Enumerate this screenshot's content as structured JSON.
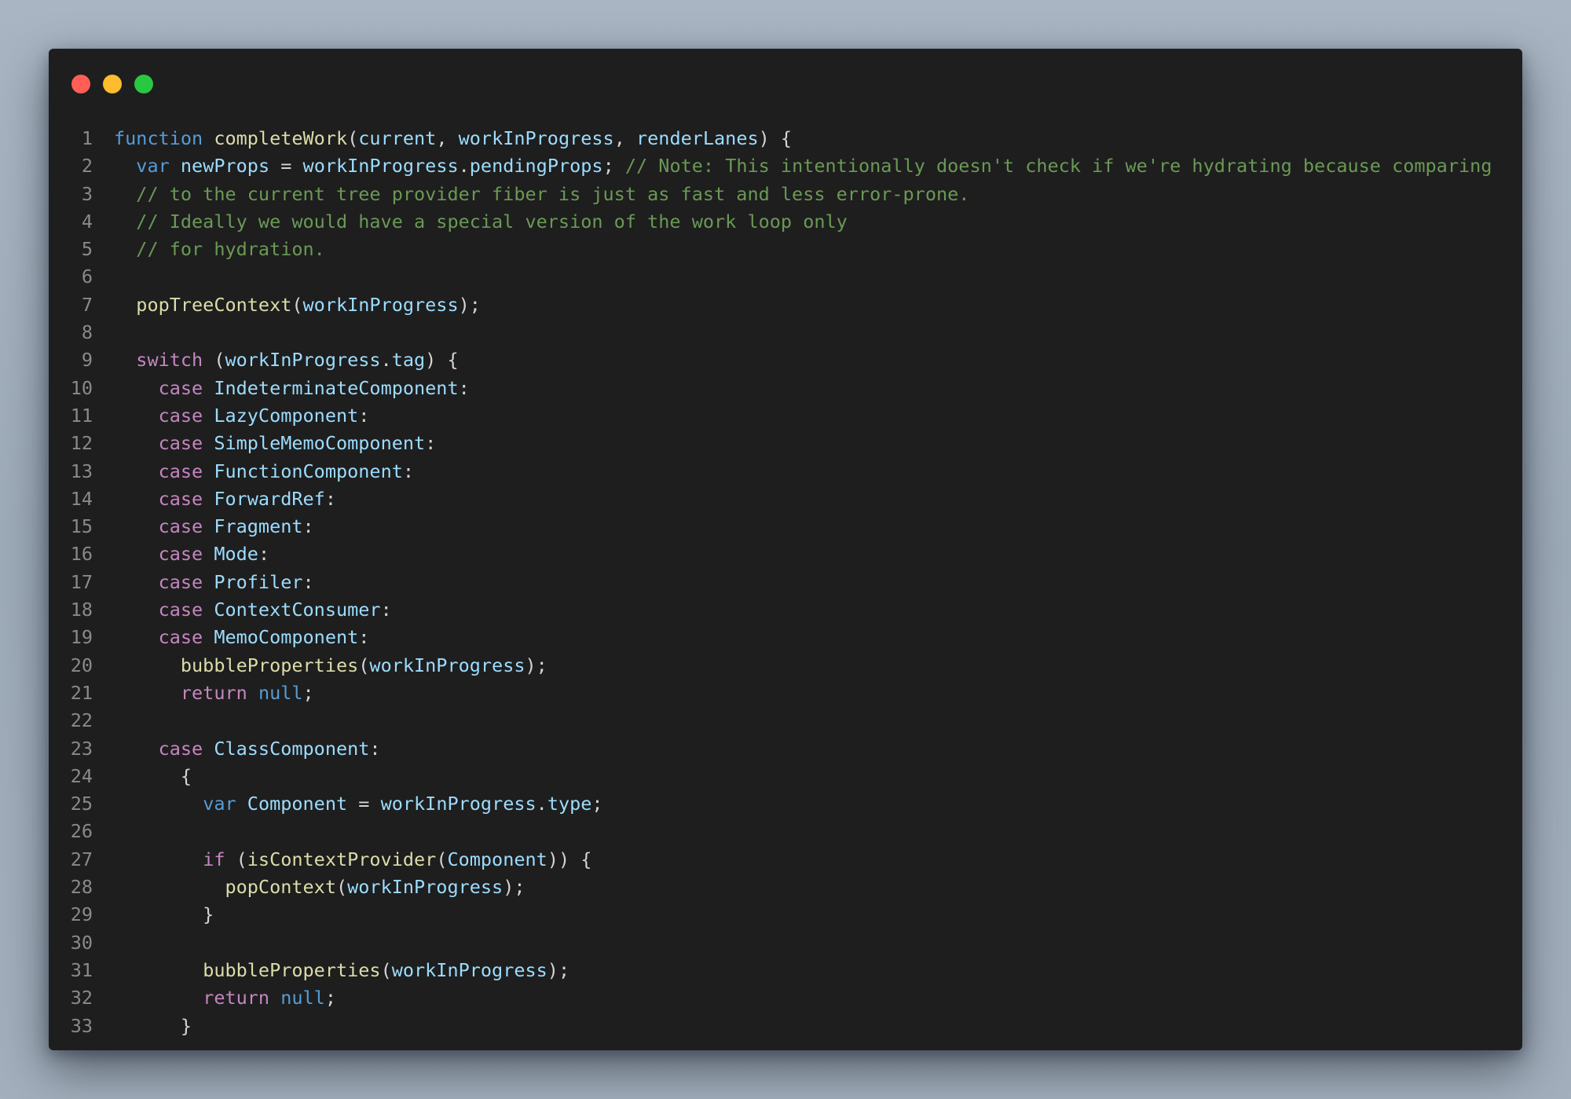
{
  "window": {
    "controls": [
      {
        "name": "close",
        "color": "#ff5f57"
      },
      {
        "name": "minimize",
        "color": "#febc2e"
      },
      {
        "name": "maximize",
        "color": "#28c840"
      }
    ]
  },
  "theme": {
    "background": "#1e1e1e",
    "keyword": "#569cd6",
    "control": "#c586c0",
    "function": "#dcdcaa",
    "variable": "#9cdcfe",
    "comment": "#6a9955",
    "plain": "#d4d4d4",
    "line_number": "#8a8a8a"
  },
  "code": {
    "lines": [
      {
        "n": "1",
        "tokens": [
          [
            "keyword",
            "function"
          ],
          [
            "plain",
            " "
          ],
          [
            "func",
            "completeWork"
          ],
          [
            "plain",
            "("
          ],
          [
            "var",
            "current"
          ],
          [
            "plain",
            ", "
          ],
          [
            "var",
            "workInProgress"
          ],
          [
            "plain",
            ", "
          ],
          [
            "var",
            "renderLanes"
          ],
          [
            "plain",
            ") {"
          ]
        ]
      },
      {
        "n": "2",
        "tokens": [
          [
            "plain",
            "  "
          ],
          [
            "keyword",
            "var"
          ],
          [
            "plain",
            " "
          ],
          [
            "var",
            "newProps"
          ],
          [
            "plain",
            " = "
          ],
          [
            "var",
            "workInProgress"
          ],
          [
            "plain",
            "."
          ],
          [
            "var",
            "pendingProps"
          ],
          [
            "plain",
            "; "
          ],
          [
            "comment",
            "// Note: This intentionally doesn't check if we're hydrating because comparing"
          ]
        ]
      },
      {
        "n": "3",
        "tokens": [
          [
            "plain",
            "  "
          ],
          [
            "comment",
            "// to the current tree provider fiber is just as fast and less error-prone."
          ]
        ]
      },
      {
        "n": "4",
        "tokens": [
          [
            "plain",
            "  "
          ],
          [
            "comment",
            "// Ideally we would have a special version of the work loop only"
          ]
        ]
      },
      {
        "n": "5",
        "tokens": [
          [
            "plain",
            "  "
          ],
          [
            "comment",
            "// for hydration."
          ]
        ]
      },
      {
        "n": "6",
        "tokens": []
      },
      {
        "n": "7",
        "tokens": [
          [
            "plain",
            "  "
          ],
          [
            "func",
            "popTreeContext"
          ],
          [
            "plain",
            "("
          ],
          [
            "var",
            "workInProgress"
          ],
          [
            "plain",
            ");"
          ]
        ]
      },
      {
        "n": "8",
        "tokens": []
      },
      {
        "n": "9",
        "tokens": [
          [
            "plain",
            "  "
          ],
          [
            "control",
            "switch"
          ],
          [
            "plain",
            " ("
          ],
          [
            "var",
            "workInProgress"
          ],
          [
            "plain",
            "."
          ],
          [
            "var",
            "tag"
          ],
          [
            "plain",
            ") {"
          ]
        ]
      },
      {
        "n": "10",
        "tokens": [
          [
            "plain",
            "    "
          ],
          [
            "control",
            "case"
          ],
          [
            "plain",
            " "
          ],
          [
            "var",
            "IndeterminateComponent"
          ],
          [
            "plain",
            ":"
          ]
        ]
      },
      {
        "n": "11",
        "tokens": [
          [
            "plain",
            "    "
          ],
          [
            "control",
            "case"
          ],
          [
            "plain",
            " "
          ],
          [
            "var",
            "LazyComponent"
          ],
          [
            "plain",
            ":"
          ]
        ]
      },
      {
        "n": "12",
        "tokens": [
          [
            "plain",
            "    "
          ],
          [
            "control",
            "case"
          ],
          [
            "plain",
            " "
          ],
          [
            "var",
            "SimpleMemoComponent"
          ],
          [
            "plain",
            ":"
          ]
        ]
      },
      {
        "n": "13",
        "tokens": [
          [
            "plain",
            "    "
          ],
          [
            "control",
            "case"
          ],
          [
            "plain",
            " "
          ],
          [
            "var",
            "FunctionComponent"
          ],
          [
            "plain",
            ":"
          ]
        ]
      },
      {
        "n": "14",
        "tokens": [
          [
            "plain",
            "    "
          ],
          [
            "control",
            "case"
          ],
          [
            "plain",
            " "
          ],
          [
            "var",
            "ForwardRef"
          ],
          [
            "plain",
            ":"
          ]
        ]
      },
      {
        "n": "15",
        "tokens": [
          [
            "plain",
            "    "
          ],
          [
            "control",
            "case"
          ],
          [
            "plain",
            " "
          ],
          [
            "var",
            "Fragment"
          ],
          [
            "plain",
            ":"
          ]
        ]
      },
      {
        "n": "16",
        "tokens": [
          [
            "plain",
            "    "
          ],
          [
            "control",
            "case"
          ],
          [
            "plain",
            " "
          ],
          [
            "var",
            "Mode"
          ],
          [
            "plain",
            ":"
          ]
        ]
      },
      {
        "n": "17",
        "tokens": [
          [
            "plain",
            "    "
          ],
          [
            "control",
            "case"
          ],
          [
            "plain",
            " "
          ],
          [
            "var",
            "Profiler"
          ],
          [
            "plain",
            ":"
          ]
        ]
      },
      {
        "n": "18",
        "tokens": [
          [
            "plain",
            "    "
          ],
          [
            "control",
            "case"
          ],
          [
            "plain",
            " "
          ],
          [
            "var",
            "ContextConsumer"
          ],
          [
            "plain",
            ":"
          ]
        ]
      },
      {
        "n": "19",
        "tokens": [
          [
            "plain",
            "    "
          ],
          [
            "control",
            "case"
          ],
          [
            "plain",
            " "
          ],
          [
            "var",
            "MemoComponent"
          ],
          [
            "plain",
            ":"
          ]
        ]
      },
      {
        "n": "20",
        "tokens": [
          [
            "plain",
            "      "
          ],
          [
            "func",
            "bubbleProperties"
          ],
          [
            "plain",
            "("
          ],
          [
            "var",
            "workInProgress"
          ],
          [
            "plain",
            ");"
          ]
        ]
      },
      {
        "n": "21",
        "tokens": [
          [
            "plain",
            "      "
          ],
          [
            "control",
            "return"
          ],
          [
            "plain",
            " "
          ],
          [
            "keyword",
            "null"
          ],
          [
            "plain",
            ";"
          ]
        ]
      },
      {
        "n": "22",
        "tokens": []
      },
      {
        "n": "23",
        "tokens": [
          [
            "plain",
            "    "
          ],
          [
            "control",
            "case"
          ],
          [
            "plain",
            " "
          ],
          [
            "var",
            "ClassComponent"
          ],
          [
            "plain",
            ":"
          ]
        ]
      },
      {
        "n": "24",
        "tokens": [
          [
            "plain",
            "      {"
          ]
        ]
      },
      {
        "n": "25",
        "tokens": [
          [
            "plain",
            "        "
          ],
          [
            "keyword",
            "var"
          ],
          [
            "plain",
            " "
          ],
          [
            "var",
            "Component"
          ],
          [
            "plain",
            " = "
          ],
          [
            "var",
            "workInProgress"
          ],
          [
            "plain",
            "."
          ],
          [
            "var",
            "type"
          ],
          [
            "plain",
            ";"
          ]
        ]
      },
      {
        "n": "26",
        "tokens": []
      },
      {
        "n": "27",
        "tokens": [
          [
            "plain",
            "        "
          ],
          [
            "control",
            "if"
          ],
          [
            "plain",
            " ("
          ],
          [
            "func",
            "isContextProvider"
          ],
          [
            "plain",
            "("
          ],
          [
            "var",
            "Component"
          ],
          [
            "plain",
            ")) {"
          ]
        ]
      },
      {
        "n": "28",
        "tokens": [
          [
            "plain",
            "          "
          ],
          [
            "func",
            "popContext"
          ],
          [
            "plain",
            "("
          ],
          [
            "var",
            "workInProgress"
          ],
          [
            "plain",
            ");"
          ]
        ]
      },
      {
        "n": "29",
        "tokens": [
          [
            "plain",
            "        }"
          ]
        ]
      },
      {
        "n": "30",
        "tokens": []
      },
      {
        "n": "31",
        "tokens": [
          [
            "plain",
            "        "
          ],
          [
            "func",
            "bubbleProperties"
          ],
          [
            "plain",
            "("
          ],
          [
            "var",
            "workInProgress"
          ],
          [
            "plain",
            ");"
          ]
        ]
      },
      {
        "n": "32",
        "tokens": [
          [
            "plain",
            "        "
          ],
          [
            "control",
            "return"
          ],
          [
            "plain",
            " "
          ],
          [
            "keyword",
            "null"
          ],
          [
            "plain",
            ";"
          ]
        ]
      },
      {
        "n": "33",
        "tokens": [
          [
            "plain",
            "      }"
          ]
        ]
      }
    ]
  }
}
